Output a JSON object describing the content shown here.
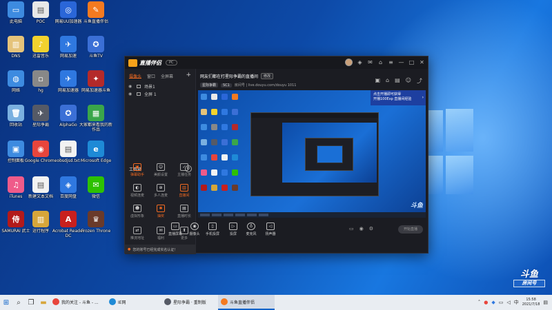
{
  "desktop_icons": [
    {
      "label": "此电脑",
      "color": "#3d8be0",
      "glyph": "▭"
    },
    {
      "label": "POC",
      "color": "#e8e8e8",
      "glyph": "▤"
    },
    {
      "label": "网易UU加速器",
      "color": "#2a66d8",
      "glyph": "◎"
    },
    {
      "label": "斗鱼直播伴侣",
      "color": "#f47a20",
      "glyph": "✎"
    },
    {
      "label": "DNS",
      "color": "#e5c37a",
      "glyph": "▥"
    },
    {
      "label": "迅雷音乐",
      "color": "#f2d22e",
      "glyph": "♪"
    },
    {
      "label": "网易加速",
      "color": "#2f78e0",
      "glyph": "✈"
    },
    {
      "label": "斗鱼TV",
      "color": "#3b6fd6",
      "glyph": "✪"
    },
    {
      "label": "网络",
      "color": "#3d8be0",
      "glyph": "◍"
    },
    {
      "label": "hg",
      "color": "#888888",
      "glyph": "▫"
    },
    {
      "label": "网易加速器",
      "color": "#2f78e0",
      "glyph": "✈"
    },
    {
      "label": "网易加速器斗鱼",
      "color": "#b42a2a",
      "glyph": "✦"
    },
    {
      "label": "回收站",
      "color": "#7ab0e0",
      "glyph": "🗑"
    },
    {
      "label": "星际争霸",
      "color": "#555a66",
      "glyph": "✈"
    },
    {
      "label": "AlphaGo",
      "color": "#3b6fd6",
      "glyph": "✪"
    },
    {
      "label": "大家都来看我的新作品",
      "color": "#3aa64a",
      "glyph": "▦"
    },
    {
      "label": "控制面板",
      "color": "#3d8be0",
      "glyph": "▣"
    },
    {
      "label": "Google Chrome",
      "color": "#e8453c",
      "glyph": "◉"
    },
    {
      "label": "obsdjsd.txt",
      "color": "#f2f2f2",
      "glyph": "▤"
    },
    {
      "label": "Microsoft Edge",
      "color": "#1e8ad6",
      "glyph": "e"
    },
    {
      "label": "iTunes",
      "color": "#ef5b8a",
      "glyph": "♫"
    },
    {
      "label": "新建文本文档",
      "color": "#f2f2f2",
      "glyph": "▤"
    },
    {
      "label": "百度网盘",
      "color": "#2f78e0",
      "glyph": "◈"
    },
    {
      "label": "微信",
      "color": "#2dc100",
      "glyph": "✉"
    },
    {
      "label": "SAMURAI 武士",
      "color": "#b31a1a",
      "glyph": "侍"
    },
    {
      "label": "运行程序",
      "color": "#d7a63a",
      "glyph": "▥"
    },
    {
      "label": "Acrobat Reader DC",
      "color": "#c8201e",
      "glyph": "A"
    },
    {
      "label": "Frozen Throne",
      "color": "#6a3a2a",
      "glyph": "♛"
    }
  ],
  "window": {
    "brand": "直播伴侣",
    "version": "PC",
    "tabs": [
      "摄像头",
      "窗口",
      "全屏幕"
    ],
    "scenes": [
      "场景1",
      "全屏 1"
    ],
    "tools_title": "工具箱",
    "tools": [
      {
        "label": "弹幕助手",
        "glyph": "▣",
        "orange": true
      },
      {
        "label": "美颜设置",
        "glyph": "☺",
        "orange": false
      },
      {
        "label": "主播任务",
        "glyph": "✓",
        "orange": false
      },
      {
        "label": "视频连麦",
        "glyph": "◐",
        "orange": false
      },
      {
        "label": "多人连麦",
        "glyph": "⊕",
        "orange": false
      },
      {
        "label": "直播间",
        "glyph": "▥",
        "orange": true
      },
      {
        "label": "虚拟形象",
        "glyph": "☻",
        "orange": false
      },
      {
        "label": "抽奖",
        "glyph": "✱",
        "orange": true
      },
      {
        "label": "直播时长",
        "glyph": "▤",
        "orange": false
      },
      {
        "label": "推流地址",
        "glyph": "⇄",
        "orange": false
      },
      {
        "label": "福利",
        "glyph": "✉",
        "orange": false
      },
      {
        "label": "更多",
        "glyph": "⬆",
        "orange": false
      }
    ],
    "notice": "您的账号已经完成实名认证！",
    "room_title": "网友们都在打星际争霸的直播间",
    "room_edit": "修改",
    "room_category": "星际争霸",
    "room_id": "SC1",
    "room_meta": "房间号 | live.douyu.com/douyu  1011",
    "promo_line1": "点击开播即可获得",
    "promo_line2": "开播100Exp 直播间经验",
    "preview_watermark": "斗鱼",
    "controls": [
      {
        "label": "直播屏幕",
        "glyph": "▭"
      },
      {
        "label": "摄像头",
        "glyph": "◉"
      },
      {
        "label": "手机投屏",
        "glyph": "▯"
      },
      {
        "label": "投屏",
        "glyph": "▷"
      },
      {
        "label": "麦克风",
        "glyph": "♁"
      },
      {
        "label": "扬声器",
        "glyph": "◁"
      }
    ],
    "start_label": "开始直播"
  },
  "taskbar": {
    "apps": [
      {
        "label": "我的关注 - 斗鱼 - ...",
        "color": "#e8453c",
        "active": false
      },
      {
        "label": "IE网",
        "color": "#1e8ad6",
        "active": false
      },
      {
        "label": "星际争霸 · 重制版",
        "color": "#555a66",
        "active": false
      },
      {
        "label": "斗鱼直播伴侣",
        "color": "#f47a20",
        "active": true
      }
    ],
    "time": "15:58",
    "date": "2021/7/18"
  },
  "badge": {
    "big": "斗鱼",
    "small": "房间号"
  }
}
